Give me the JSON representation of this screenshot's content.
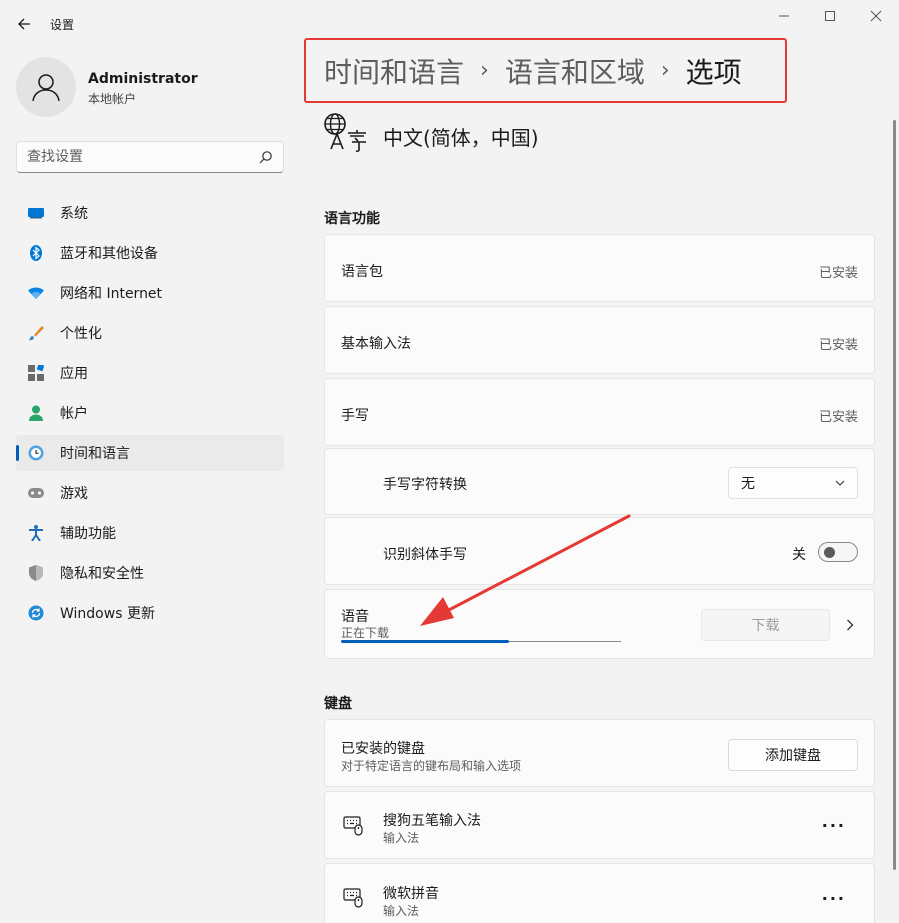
{
  "window": {
    "title": "设置"
  },
  "profile": {
    "name": "Administrator",
    "account_type": "本地帐户"
  },
  "search": {
    "placeholder": "查找设置"
  },
  "nav": {
    "items": [
      {
        "label": "系统"
      },
      {
        "label": "蓝牙和其他设备"
      },
      {
        "label": "网络和 Internet"
      },
      {
        "label": "个性化"
      },
      {
        "label": "应用"
      },
      {
        "label": "帐户"
      },
      {
        "label": "时间和语言"
      },
      {
        "label": "游戏"
      },
      {
        "label": "辅助功能"
      },
      {
        "label": "隐私和安全性"
      },
      {
        "label": "Windows 更新"
      }
    ],
    "active_index": 6
  },
  "breadcrumb": {
    "items": [
      "时间和语言",
      "语言和区域",
      "选项"
    ],
    "separator": "›"
  },
  "language": {
    "title": "中文(简体，中国)"
  },
  "sections": {
    "features_title": "语言功能",
    "keyboard_title": "键盘"
  },
  "features": {
    "lang_pack": {
      "label": "语言包",
      "status": "已安装"
    },
    "basic_input": {
      "label": "基本输入法",
      "status": "已安装"
    },
    "handwriting": {
      "label": "手写",
      "status": "已安装"
    },
    "hw_convert": {
      "label": "手写字符转换",
      "selected": "无"
    },
    "italic": {
      "label": "识别斜体手写",
      "state_label": "关"
    },
    "speech": {
      "label": "语音",
      "status": "正在下载",
      "download_label": "下载",
      "progress": 0.6
    }
  },
  "keyboard": {
    "installed": {
      "label": "已安装的键盘",
      "description": "对于特定语言的键布局和输入选项",
      "add_label": "添加键盘"
    },
    "items": [
      {
        "label": "搜狗五笔输入法",
        "type": "输入法"
      },
      {
        "label": "微软拼音",
        "type": "输入法"
      }
    ],
    "more_label": "···"
  },
  "colors": {
    "accent": "#005fb8",
    "highlight_box": "#e53935",
    "annotation_arrow": "#e53935"
  }
}
